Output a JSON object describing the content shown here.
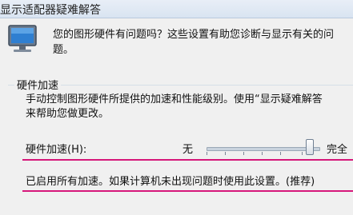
{
  "window": {
    "title": "显示适配器疑难解答"
  },
  "intro": {
    "line1": "您的图形硬件有问题吗？这些设置有助您诊断与显示有关的问",
    "line2": "题。"
  },
  "hardware_acceleration": {
    "group_label": "硬件加速",
    "description_line1": "手动控制图形硬件所提供的加速和性能级别。使用“显示疑难解答",
    "description_line2": "来帮助您做更改。",
    "slider_label": "硬件加速(H):",
    "slider_min_label": "无",
    "slider_max_label": "完全",
    "slider_value_fraction": 1.0,
    "status": "已启用所有加速。如果计算机未出现问题时使用此设置。(推荐)"
  },
  "icons": [
    "monitor-icon"
  ],
  "colors": {
    "annotation_underline": "#d6177a"
  }
}
